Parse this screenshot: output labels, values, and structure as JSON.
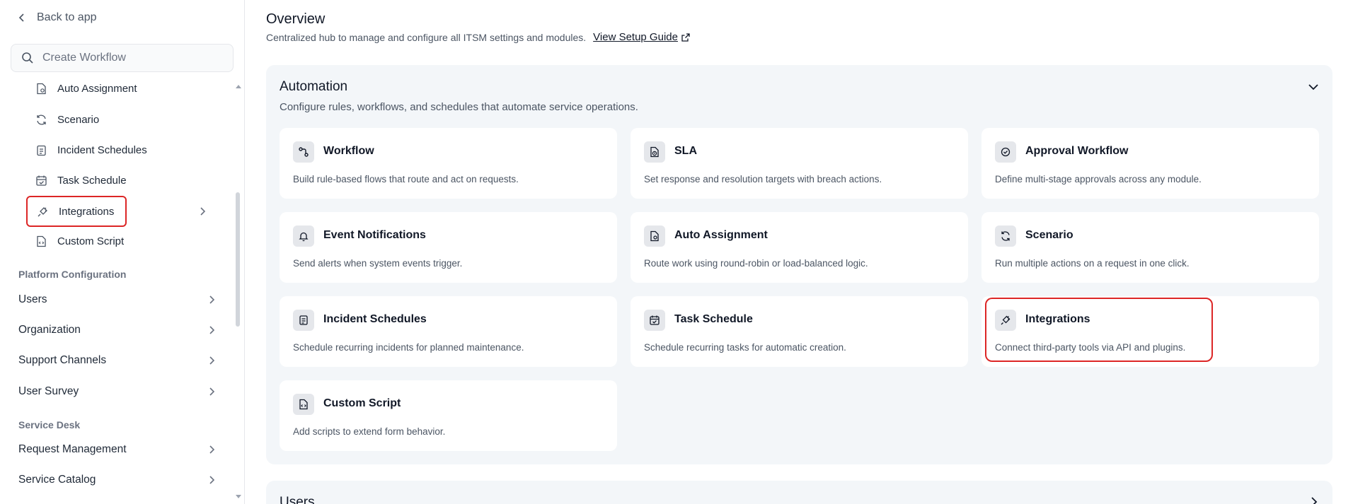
{
  "sidebar": {
    "back_label": "Back to app",
    "search_placeholder": "Create Workflow",
    "sub_items": [
      {
        "label": "Auto Assignment",
        "icon": "file-gear-icon"
      },
      {
        "label": "Scenario",
        "icon": "refresh-icon"
      },
      {
        "label": "Incident Schedules",
        "icon": "clipboard-icon"
      },
      {
        "label": "Task Schedule",
        "icon": "calendar-check-icon"
      },
      {
        "label": "Integrations",
        "icon": "plug-icon"
      },
      {
        "label": "Custom Script",
        "icon": "file-code-icon"
      }
    ],
    "platform_label": "Platform Configuration",
    "platform_items": [
      "Users",
      "Organization",
      "Support Channels",
      "User Survey"
    ],
    "service_label": "Service Desk",
    "service_items": [
      "Request Management",
      "Service Catalog"
    ]
  },
  "main": {
    "title": "Overview",
    "subtitle": "Centralized hub to manage and configure all ITSM settings and modules.",
    "guide_link": "View Setup Guide",
    "automation": {
      "title": "Automation",
      "subtitle": "Configure rules, workflows, and schedules that automate service operations.",
      "cards": [
        {
          "title": "Workflow",
          "desc": "Build rule-based flows that route and act on requests.",
          "icon": "workflow-icon"
        },
        {
          "title": "SLA",
          "desc": "Set response and resolution targets with breach actions.",
          "icon": "file-clock-icon"
        },
        {
          "title": "Approval Workflow",
          "desc": "Define multi-stage approvals across any module.",
          "icon": "check-circle-icon"
        },
        {
          "title": "Event Notifications",
          "desc": "Send alerts when system events trigger.",
          "icon": "bell-icon"
        },
        {
          "title": "Auto Assignment",
          "desc": "Route work using round-robin or load-balanced logic.",
          "icon": "file-gear-icon"
        },
        {
          "title": "Scenario",
          "desc": "Run multiple actions on a request in one click.",
          "icon": "refresh-icon"
        },
        {
          "title": "Incident Schedules",
          "desc": "Schedule recurring incidents for planned maintenance.",
          "icon": "clipboard-icon"
        },
        {
          "title": "Task Schedule",
          "desc": "Schedule recurring tasks for automatic creation.",
          "icon": "calendar-check-icon"
        },
        {
          "title": "Integrations",
          "desc": "Connect third-party tools via API and plugins.",
          "icon": "plug-icon"
        },
        {
          "title": "Custom Script",
          "desc": "Add scripts to extend form behavior.",
          "icon": "file-code-icon"
        }
      ]
    },
    "users_section": {
      "title": "Users"
    }
  },
  "colors": {
    "highlight": "#dc2626",
    "panel_bg": "#f3f6f9"
  }
}
